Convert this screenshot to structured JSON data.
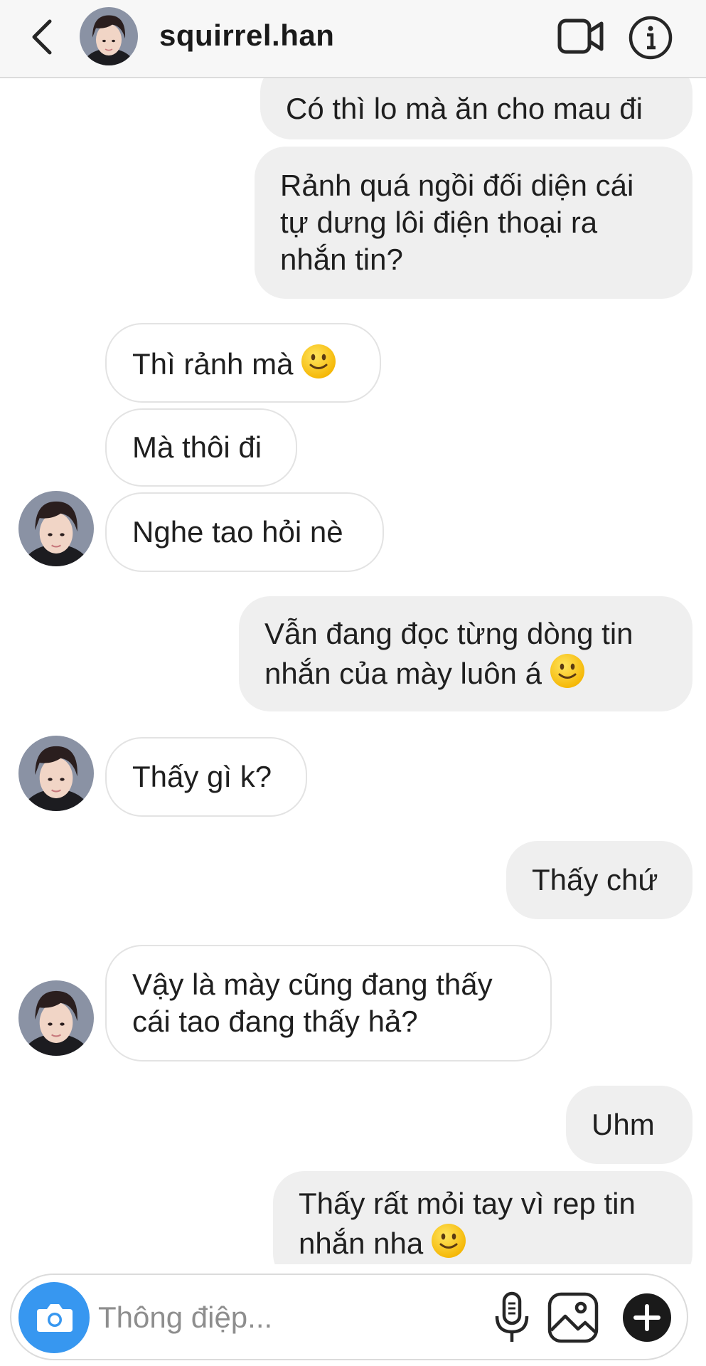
{
  "header": {
    "username": "squirrel.han",
    "icons": {
      "back": "chevron-left-icon",
      "video": "video-camera-icon",
      "info": "info-icon"
    }
  },
  "messages": [
    {
      "sender": "me",
      "lines": [
        "Có thì lo mà ăn cho mau đi"
      ]
    },
    {
      "sender": "me",
      "lines": [
        "Rảnh quá ngồi đối diện cái",
        "tự dưng lôi điện thoại ra",
        "nhắn tin?"
      ]
    },
    {
      "sender": "them",
      "lines": [
        "Thì rảnh mà"
      ],
      "emoji": "slightly-smiling-face"
    },
    {
      "sender": "them",
      "lines": [
        "Mà thôi đi"
      ]
    },
    {
      "sender": "them",
      "lines": [
        "Nghe tao hỏi nè"
      ]
    },
    {
      "sender": "me",
      "lines": [
        "Vẫn đang đọc từng dòng tin",
        "nhắn của mày luôn á"
      ],
      "emoji": "slightly-smiling-face"
    },
    {
      "sender": "them",
      "lines": [
        "Thấy gì k?"
      ]
    },
    {
      "sender": "me",
      "lines": [
        "Thấy chứ"
      ]
    },
    {
      "sender": "them",
      "lines": [
        "Vậy là mày cũng đang thấy",
        "cái tao đang thấy hả?"
      ]
    },
    {
      "sender": "me",
      "lines": [
        "Uhm"
      ]
    },
    {
      "sender": "me",
      "lines": [
        "Thấy rất mỏi tay vì rep tin",
        "nhắn nha"
      ],
      "emoji": "slightly-smiling-face"
    }
  ],
  "composer": {
    "placeholder": "Thông điệp...",
    "value": "",
    "icons": {
      "camera": "camera-icon",
      "mic": "microphone-icon",
      "gallery": "image-gallery-icon",
      "add": "plus-circle-icon"
    }
  },
  "colors": {
    "accent": "#3797f0",
    "my_bubble": "#efefef",
    "their_bubble_border": "#e3e3e3",
    "header_bg": "#f7f7f7"
  }
}
